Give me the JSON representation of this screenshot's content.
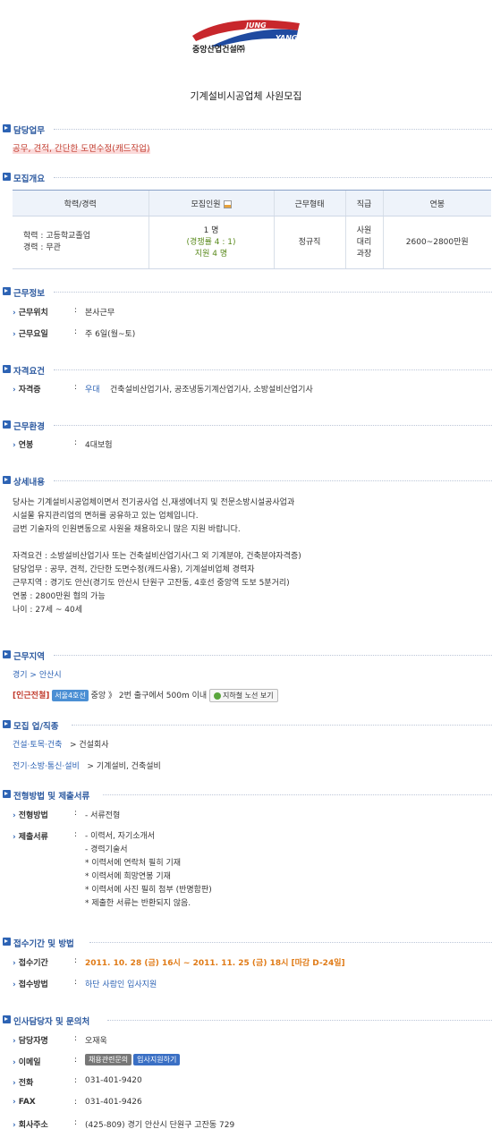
{
  "company": {
    "name": "중앙산업건설㈜",
    "logo_en_1": "JUNG",
    "logo_en_2": "YANG"
  },
  "page_title": "기계설비시공업체 사원모집",
  "sections": {
    "duty": {
      "title": "담당업무",
      "text": "공무, 견적, 간단한 도면수정(캐드작업)"
    },
    "recruit": {
      "title": "모집개요",
      "headers": [
        "학력/경력",
        "모집인원",
        "근무형태",
        "직급",
        "연봉"
      ],
      "education": "학력 : 고등학교졸업",
      "career": "경력 : 무관",
      "headcount": "1 명",
      "competition": "(경쟁률 4 : 1)",
      "applicants": "지원 4 명",
      "work_type": "정규직",
      "ranks": [
        "사원",
        "대리",
        "과장"
      ],
      "salary": "2600~2800만원"
    },
    "work_info": {
      "title": "근무정보",
      "rows": [
        {
          "label": "근무위치",
          "value": "본사근무"
        },
        {
          "label": "근무요일",
          "value": "주 6일(월~토)"
        }
      ]
    },
    "qualification": {
      "title": "자격요건",
      "label": "자격증",
      "prefer": "우대",
      "value": "건축설비산업기사, 공조냉동기계산업기사, 소방설비산업기사"
    },
    "environment": {
      "title": "근무환경",
      "label": "연봉",
      "value": "4대보험"
    },
    "detail": {
      "title": "상세내용",
      "lines": [
        "당사는 기계설비시공업체이면서 전기공사업 신,재생에너지 및 전문소방시설공사업과",
        "시설물 유지관리업의 면허를 공유하고 있는 업체입니다.",
        "금번 기술자의 인원변동으로 사원을 채용하오니 많은 지원 바랍니다.",
        "",
        "자격요건 : 소방설비산업기사 또는 건축설비산업기사(그 외 기계분야, 건축분야자격증)",
        "담당업무 : 공무, 견적, 간단한 도면수정(캐드사용), 기계설비업체 경력자",
        "근무지역 : 경기도 안산(경기도 안산시 단원구 고잔동, 4호선 중앙역 도보 5분거리)",
        "연봉 : 2800만원 협의 가능",
        "나이 : 27세 ~ 40세"
      ]
    },
    "location": {
      "title": "근무지역",
      "region": "경기 > 안산시",
      "subway_prefix": "[인근전철]",
      "subway_line": "서울4호선",
      "subway_desc": "중앙 》 2번 출구에서 500m 이내",
      "subway_button": "지하철 노선 보기"
    },
    "category": {
      "title": "모집 업/직종",
      "row1_link": "건설·토목·건축",
      "row1_value": "> 건설회사",
      "row2_link": "전기·소방·통신·설비",
      "row2_value": "> 기계설비, 건축설비"
    },
    "process": {
      "title": "전형방법 및 제출서류",
      "method_label": "전형방법",
      "method_value": "- 서류전형",
      "docs_label": "제출서류",
      "docs": [
        "- 이력서, 자기소개서",
        "- 경력기술서",
        "* 이력서에 연락처 필히 기재",
        "* 이력서에 희망연봉 기재",
        "* 이력서에 사진 필히 첨부 (반명함판)",
        "* 제출한 서류는 반환되지 않음."
      ]
    },
    "period": {
      "title": "접수기간 및 방법",
      "period_label": "접수기간",
      "period_value": "2011. 10. 28 (금) 16시 ~ 2011. 11. 25 (금) 18시 [마감 D-24일]",
      "method_label": "접수방법",
      "method_value": "하단 사람인 입사지원"
    },
    "contact": {
      "title": "인사담당자 및 문의처",
      "name_label": "담당자명",
      "name_value": "오재욱",
      "email_label": "이메일",
      "email_btn1": "채용관련문의",
      "email_btn2": "입사지원하기",
      "phone_label": "전화",
      "phone_value": "031-401-9420",
      "fax_label": "FAX",
      "fax_value": "031-401-9426",
      "address_label": "회사주소",
      "address_value": "(425-809) 경기 안산시 단원구 고잔동 729"
    }
  },
  "colors": {
    "section_blue": "#2d5aa0",
    "highlight_red": "#c0392b",
    "period_orange": "#e07b17"
  }
}
